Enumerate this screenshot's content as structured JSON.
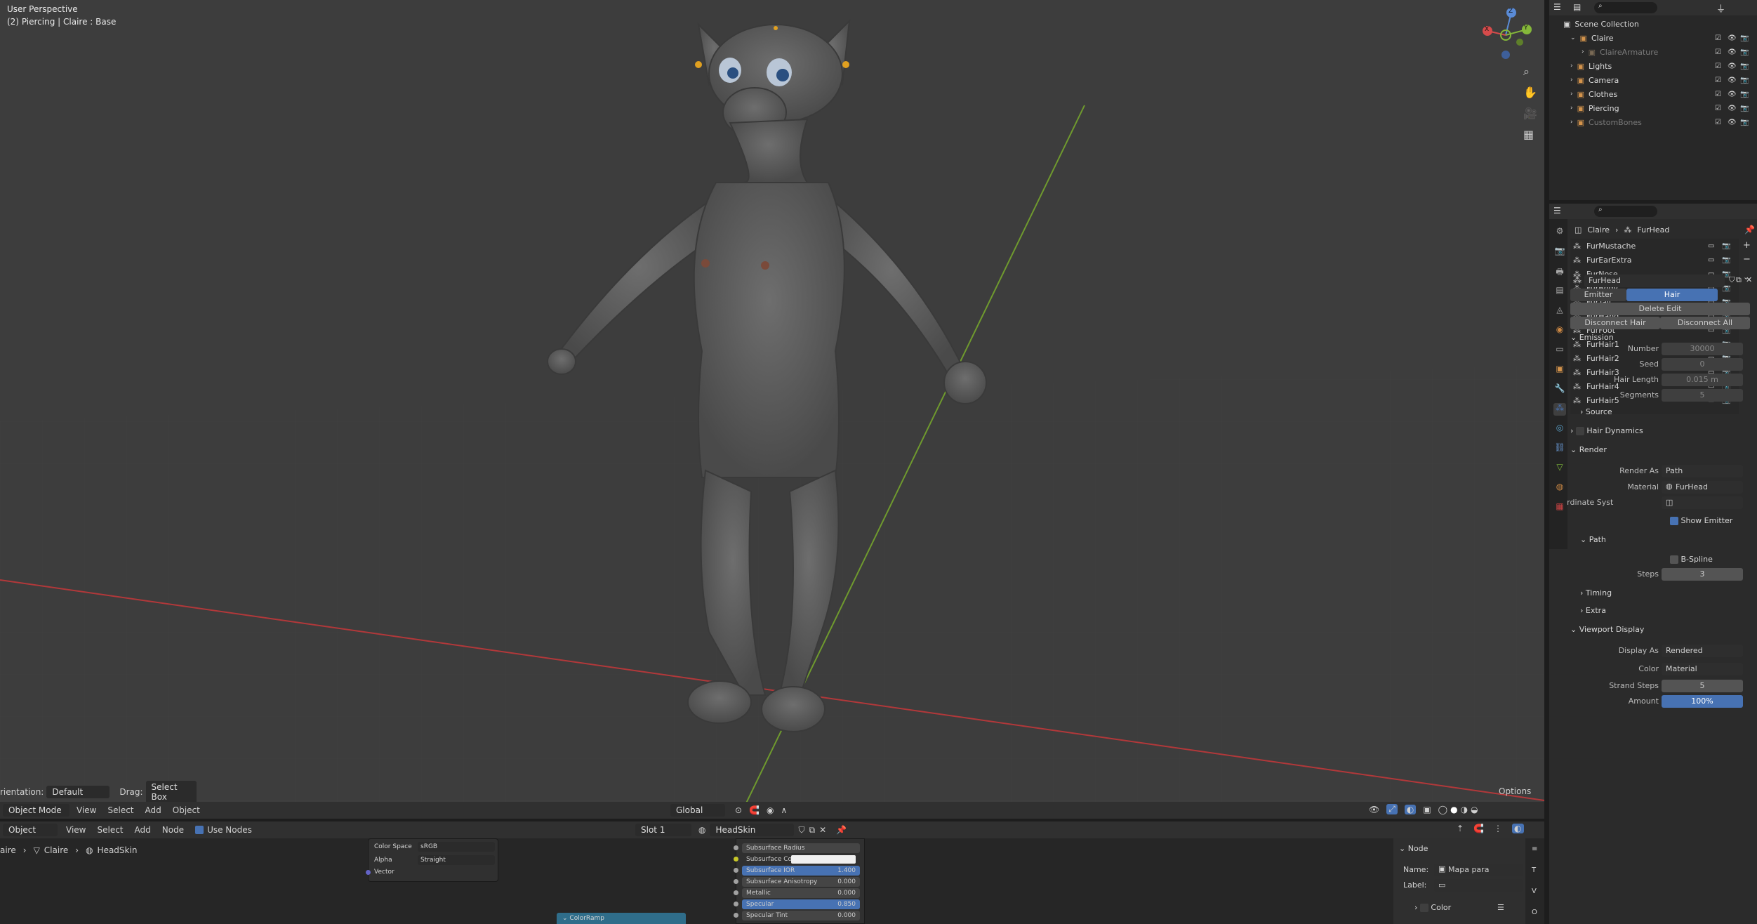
{
  "viewport": {
    "title": "User Perspective",
    "subtitle": "(2) Piercing | Claire : Base",
    "orientation_label": "rientation:",
    "orientation_value": "Default",
    "drag_label": "Drag:",
    "drag_value": "Select Box",
    "options_label": "Options",
    "transform_space": "Global",
    "mode": "Object Mode",
    "menu": [
      "View",
      "Select",
      "Add",
      "Object"
    ]
  },
  "gizmo": {
    "z": "Z",
    "y": "Y",
    "x": "X"
  },
  "outliner": {
    "scene_collection": "Scene Collection",
    "items": [
      {
        "label": "Claire",
        "dim": false
      },
      {
        "label": "ClaireArmature",
        "dim": true
      },
      {
        "label": "Lights",
        "dim": false
      },
      {
        "label": "Camera",
        "dim": false
      },
      {
        "label": "Clothes",
        "dim": false
      },
      {
        "label": "Piercing",
        "dim": false
      },
      {
        "label": "CustomBones",
        "dim": true
      }
    ]
  },
  "properties": {
    "breadcrumb_object": "Claire",
    "breadcrumb_system": "FurHead",
    "particle_systems": [
      "FurMustache",
      "FurEarExtra",
      "FurNose",
      "FurBody",
      "FurTail",
      "FurHand",
      "FurFoot",
      "FurHair1",
      "FurHair2",
      "FurHair3",
      "FurHair4",
      "FurHair5"
    ],
    "settings_name": "FurHead",
    "type_emitter": "Emitter",
    "type_hair": "Hair",
    "delete_edit": "Delete Edit",
    "disconnect_hair": "Disconnect Hair",
    "disconnect_all": "Disconnect All",
    "emission": {
      "title": "Emission",
      "number_label": "Number",
      "number_value": "30000",
      "seed_label": "Seed",
      "seed_value": "0",
      "hair_length_label": "Hair Length",
      "hair_length_value": "0.015 m",
      "segments_label": "Segments",
      "segments_value": "5"
    },
    "source": "Source",
    "hair_dynamics": "Hair Dynamics",
    "render": {
      "title": "Render",
      "render_as_label": "Render As",
      "render_as_value": "Path",
      "material_label": "Material",
      "material_value": "FurHead",
      "coord_label": "Coordinate Syst",
      "show_emitter": "Show Emitter",
      "path_title": "Path",
      "bspline": "B-Spline",
      "steps_label": "Steps",
      "steps_value": "3",
      "timing": "Timing",
      "extra": "Extra"
    },
    "viewport_display": {
      "title": "Viewport Display",
      "display_as_label": "Display As",
      "display_as_value": "Rendered",
      "color_label": "Color",
      "color_value": "Material",
      "strand_steps_label": "Strand Steps",
      "strand_steps_value": "5",
      "amount_label": "Amount",
      "amount_value": "100%"
    }
  },
  "node_editor": {
    "editor_type": "Object",
    "menu": [
      "View",
      "Select",
      "Add",
      "Node"
    ],
    "use_nodes": "Use Nodes",
    "slot": "Slot 1",
    "material": "HeadSkin",
    "breadcrumb": [
      "aire",
      "Claire",
      "HeadSkin"
    ],
    "image_node": {
      "color_space_label": "Color Space",
      "color_space_value": "sRGB",
      "alpha_label": "Alpha",
      "alpha_value": "Straight",
      "vector": "Vector"
    },
    "colorramp": "ColorRamp",
    "bsdf_rows": [
      {
        "label": "Subsurface Radius",
        "value": ""
      },
      {
        "label": "Subsurface Colo",
        "value": ""
      },
      {
        "label": "Subsurface IOR",
        "value": "1.400"
      },
      {
        "label": "Subsurface Anisotropy",
        "value": "0.000"
      },
      {
        "label": "Metallic",
        "value": "0.000"
      },
      {
        "label": "Specular",
        "value": "0.850"
      },
      {
        "label": "Specular Tint",
        "value": "0.000"
      }
    ],
    "sidebar": {
      "node_title": "Node",
      "name_label": "Name:",
      "name_value": "Mapa para normais",
      "label_label": "Label:",
      "color": "Color"
    }
  },
  "colors": {
    "accent": "#4772b3",
    "viewport_bg": "#3d3d3d",
    "x_axis": "#c0392b",
    "y_axis": "#7fb83a",
    "panel": "#2b2b2b"
  }
}
